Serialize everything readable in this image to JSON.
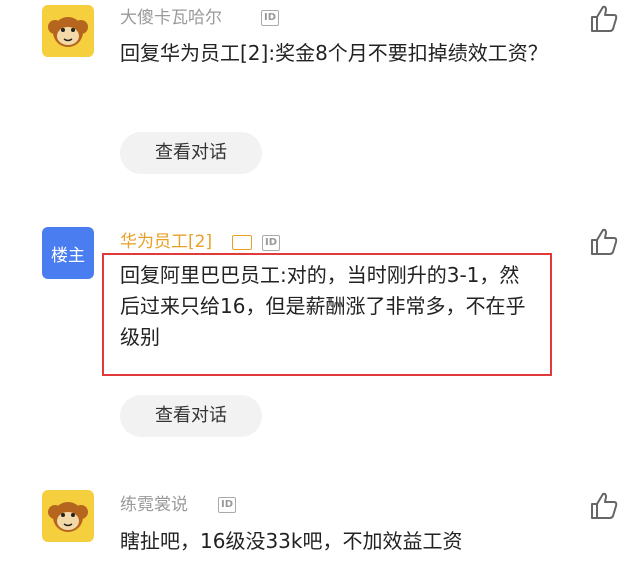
{
  "comments": [
    {
      "username": "大傻卡瓦哈尔",
      "id_tag": "ID",
      "text": "回复华为员工[2]:奖金8个月不要扣掉绩效工资？",
      "dialog_label": "查看对话"
    },
    {
      "badge": "楼主",
      "username": "华为员工[2]",
      "id_tag": "ID",
      "text": "回复阿里巴巴员工:对的，当时刚升的3-1，然后过来只给16，但是薪酬涨了非常多，不在乎级别",
      "dialog_label": "查看对话"
    },
    {
      "username": "练霓裳说",
      "id_tag": "ID",
      "text": "瞎扯吧，16级没33k吧，不加效益工资"
    }
  ],
  "icons": {
    "like": "thumbs-up-icon",
    "avatar": "monkey-avatar-icon",
    "image": "image-icon"
  },
  "colors": {
    "op_name": "#e8a027",
    "badge_bg": "#4a7df0",
    "highlight": "#e23a3a"
  }
}
